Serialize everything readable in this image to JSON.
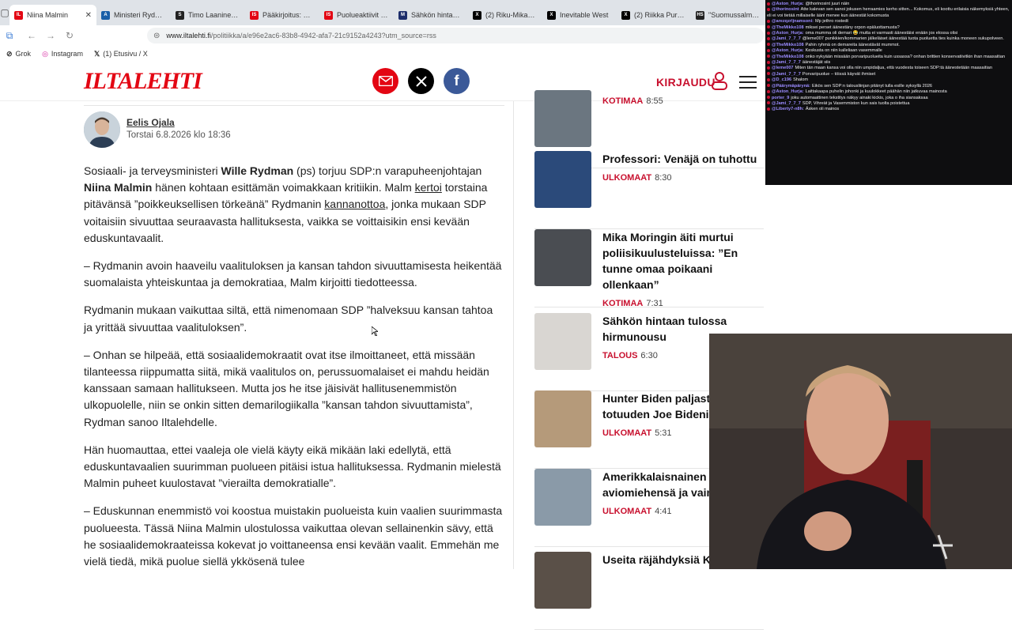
{
  "browser": {
    "tabs": [
      {
        "title": "Niina Malmin",
        "favicon": "IL",
        "color": "#e30613",
        "active": true
      },
      {
        "title": "Ministeri Rydman",
        "favicon": "A",
        "color": "#1a5fa8"
      },
      {
        "title": "Timo Laaninen ju",
        "favicon": "S",
        "color": "#222"
      },
      {
        "title": "Pääkirjoitus: Entä",
        "favicon": "IS",
        "color": "#e30613"
      },
      {
        "title": "Puolueaktiivit ker",
        "favicon": "IS",
        "color": "#e30613"
      },
      {
        "title": "Sähkön hintavert",
        "favicon": "M",
        "color": "#1c2d6b"
      },
      {
        "title": "(2) Riku-Mikael La",
        "favicon": "X",
        "color": "#000"
      },
      {
        "title": "Inevitable West",
        "favicon": "X",
        "color": "#000"
      },
      {
        "title": "(2) Riikka Purra X",
        "favicon": "X",
        "color": "#000"
      },
      {
        "title": "\"Suomussalmen S",
        "favicon": "HS",
        "color": "#222"
      }
    ],
    "url_host": "www.iltalehti.fi",
    "url_path": "/politiikka/a/e96e2ac6-83b8-4942-afa7-21c9152a4243?utm_source=rss",
    "bookmarks": [
      {
        "label": "Grok"
      },
      {
        "label": "Instagram"
      },
      {
        "label": "(1) Etusivu / X"
      }
    ]
  },
  "site": {
    "logo": "ILTALEHTI",
    "login_label": "KIRJAUDU",
    "brand_color": "#e30613"
  },
  "article": {
    "author": "Eelis Ojala",
    "date": "Torstai 6.8.2026 klo 18:36",
    "p1_a": "Sosiaali- ja terveysministeri ",
    "p1_b": "Wille Rydman",
    "p1_c": " (ps) torjuu SDP:n varapuheenjohtajan ",
    "p1_d": "Niina Malmin",
    "p1_e": " hänen kohtaan esittämän voimakkaan kritiikin. Malm ",
    "p1_link1": "kertoi",
    "p1_f": " torstaina pitävänsä ”poikkeuksellisen törkeänä” Rydmanin ",
    "p1_link2": "kannanottoa",
    "p1_g": ", jonka mukaan SDP voitaisiin sivuuttaa seuraavasta hallituksesta, vaikka se voittaisikin ensi kevään eduskuntavaalit.",
    "p2": "– Rydmanin avoin haaveilu vaalituloksen ja kansan tahdon sivuuttamisesta heikentää suomalaista yhteiskuntaa ja demokratiaa, Malm kirjoitti tiedotteessa.",
    "p3": "Rydmanin mukaan vaikuttaa siltä, että nimenomaan SDP ”halveksuu kansan tahtoa ja yrittää sivuuttaa vaalituloksen”.",
    "p4": "– Onhan se hilpeää, että sosiaalidemokraatit ovat itse ilmoittaneet, että missään tilanteessa riippumatta siitä, mikä vaalitulos on, perussuomalaiset ei mahdu heidän kanssaan samaan hallitukseen. Mutta jos he itse jäisivät hallitusenemmistön ulkopuolelle, niin se onkin sitten demarilogiikalla ”kansan tahdon sivuuttamista”, Rydman sanoo Iltalehdelle.",
    "p5": "Hän huomauttaa, ettei vaaleja ole vielä käyty eikä mikään laki edellytä, että eduskuntavaalien suurimman puolueen pitäisi istua hallituksessa. Rydmanin mielestä Malmin puheet kuulostavat ”vierailta demokratialle”.",
    "p6": "– Eduskunnan enemmistö voi koostua muistakin puolueista kuin vaalien suurimmasta puolueesta. Tässä Niina Malmin ulostulossa vaikuttaa olevan sellainenkin sävy, että he sosiaalidemokraateissa kokevat jo voittaneensa ensi kevään vaalit. Emmehän me vielä tiedä, mikä puolue siellä ykkösenä tulee"
  },
  "sidebar": {
    "items": [
      {
        "title": "",
        "category": "KOTIMAA",
        "time": "8:55",
        "thumb": "#6b7680"
      },
      {
        "title": "Professori: Venäjä on tuhottu",
        "category": "ULKOMAAT",
        "time": "8:30",
        "thumb": "#2b4a7a"
      },
      {
        "title": "Mika Moringin äiti murtui poliisikuulusteluissa: ”En tunne omaa poikaani ollenkaan”",
        "category": "KOTIMAA",
        "time": "7:31",
        "thumb": "#4a4d52"
      },
      {
        "title": "Sähkön hintaan tulossa hirmunousu",
        "category": "TALOUS",
        "time": "6:30",
        "thumb": "#d9d6d2"
      },
      {
        "title": "Hunter Biden paljastaa totuuden Joe Bidenin",
        "category": "ULKOMAAT",
        "time": "5:31",
        "thumb": "#b59a7a"
      },
      {
        "title": "Amerikkalaisnainen s ensin aviomiehensä ja vaimonsa",
        "category": "ULKOMAAT",
        "time": "4:41",
        "thumb": "#8a9aa8"
      },
      {
        "title": "Useita räjähdyksiä Ki",
        "category": "",
        "time": "",
        "thumb": "#5a5048"
      }
    ]
  },
  "chat": {
    "lines": [
      {
        "user": "@Aston_Hurja:",
        "text": "@thorinosint juuri näin"
      },
      {
        "user": "@thorinosint",
        "text": "Atte kalevan sen sanoi jokusen herraamies kerho sitten... Kokomus, eli koottu erilaisia näkemyksiä yhteen, eli ei voi tietää millaiselle äänl menee kun äänestät kokomusta"
      },
      {
        "user": "@arezqzrljnamsoni:",
        "text": "Mp jethro rostedt"
      },
      {
        "user": "@TheMikko108",
        "text": "miksei perset äänestäny orpon epäluottamusta?"
      },
      {
        "user": "@Aston_Hurja:",
        "text": "oma mumma oli demari 😂 mutta ei varmasti äänestäisi enään jos elossa olisi"
      },
      {
        "user": "@Jami_7_7_7",
        "text": "@leme007 punikkien/kommarien jälkeläiset äänestää tuota puoluetta ties kuinka moneen sukupolveen."
      },
      {
        "user": "@TheMikko108",
        "text": "Pahin ryhmä on demareita äänestävät mummot."
      },
      {
        "user": "@Aston_Hurja:",
        "text": "Keskusta on niin kalleliaan vasemmalle"
      },
      {
        "user": "@TheMikko108",
        "text": "onko nykyään missään porvaripuolueita kuin ussassa? onhan brittien konservatiivitkin ihan maasaitian"
      },
      {
        "user": "@Jami_7_7_7",
        "text": "äänestäjät siis"
      },
      {
        "user": "@leme007",
        "text": "Miten tän maan kansa voi olla niin umpidaljua, että vuodesta toiseen SDP:tä äänestetään maasaitian"
      },
      {
        "user": "@Jami_7_7_7",
        "text": "Porvaripuolue – töissä käyvät ihmiset"
      },
      {
        "user": "@D_c196",
        "text": "Shalom"
      },
      {
        "user": "@Päärymäpärynä:",
        "text": "Eikös sen SDP:n talousliinjan pitänyt tulla esille syksyllä 2026"
      },
      {
        "user": "@Aston_Hurja:",
        "text": "Laittakaapa puhelin johonki ja kuulokkeet päähän niin jatkuvaa mainosta"
      },
      {
        "user": "porter_9",
        "text": "joku automaattinen tekstitys näkyy ainaki kickis, joka o iha siansaksaa"
      },
      {
        "user": "@Jami_7_7_7",
        "text": "SDP, Vihreät ja Vasemmiston kun sais tuolta poistettua"
      },
      {
        "user": "@Liberty7-n8h:",
        "text": "Äsken oli mainos"
      }
    ]
  }
}
